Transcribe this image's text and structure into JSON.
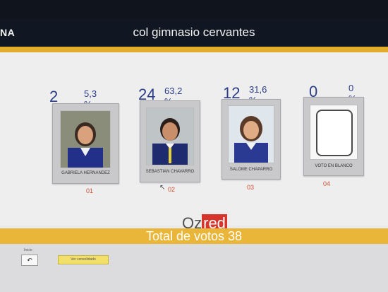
{
  "window": {
    "title_left": "NA",
    "title": "col gimnasio cervantes"
  },
  "candidates": [
    {
      "count": "2",
      "percent": "5,3 %",
      "name": "GABRIELA HERNANDEZ",
      "number": "01"
    },
    {
      "count": "24",
      "percent": "63,2 %",
      "name": "SEBASTIAN CHAVARRO",
      "number": "02"
    },
    {
      "count": "12",
      "percent": "31,6 %",
      "name": "SALOME CHAPARRO",
      "number": "03"
    },
    {
      "count": "0",
      "percent": "0 %",
      "name": "VOTO EN BLANCO",
      "number": "04"
    }
  ],
  "logo": {
    "prefix": "Oz",
    "suffix": "red"
  },
  "total": {
    "label": "Total de votos 38"
  },
  "bottom": {
    "section_label": "Inicio",
    "back_icon": "back-arrow-icon",
    "consolidated_label": "Ver consolidado"
  },
  "colors": {
    "accent_yellow": "#e2ad2c",
    "count_blue": "#2a3d86",
    "number_red": "#d04d2e",
    "title_bar": "#111722"
  }
}
